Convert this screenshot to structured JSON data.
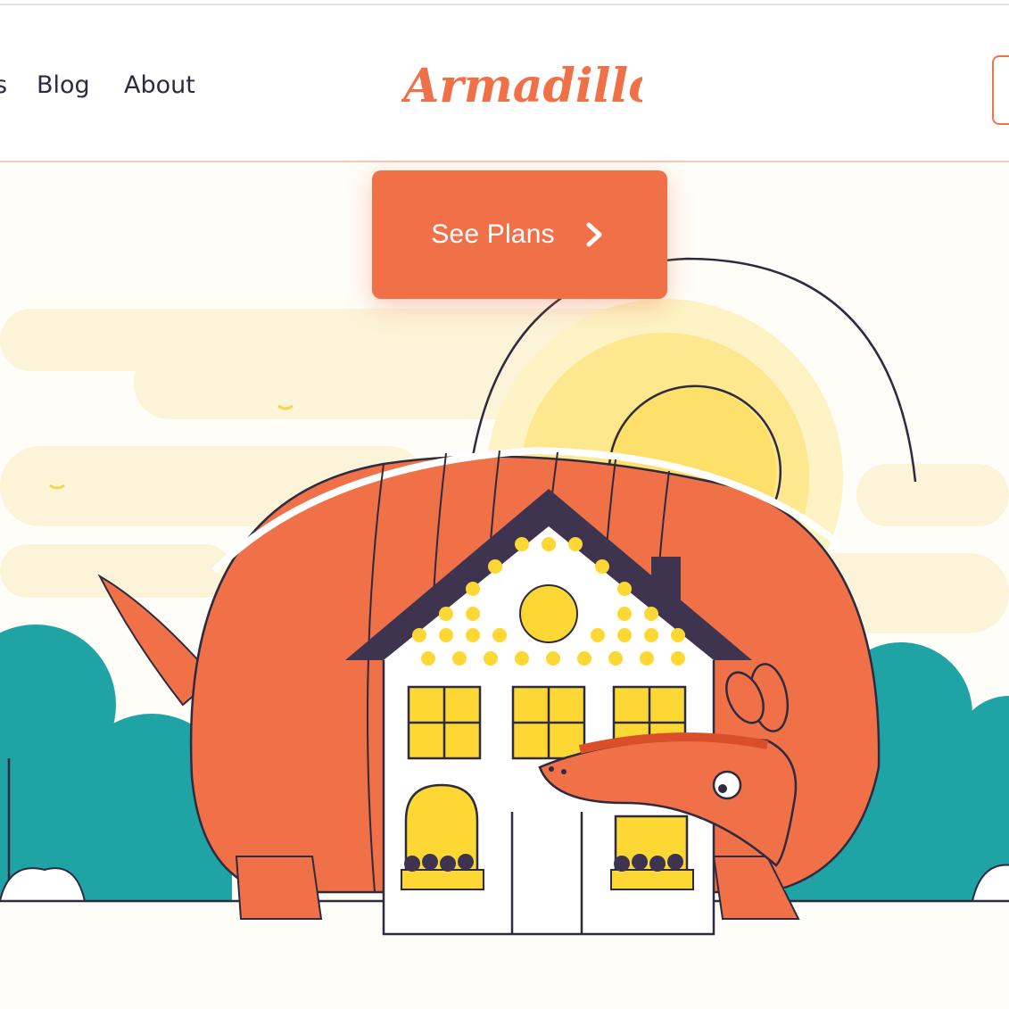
{
  "header": {
    "nav_partial": "s",
    "nav": [
      {
        "label": "Blog"
      },
      {
        "label": "About"
      }
    ],
    "logo_text": "Armadillo"
  },
  "hero": {
    "cta_label": "See Plans",
    "cta_icon": "chevron-right-icon",
    "illustration": "armadillo-around-house"
  },
  "colors": {
    "brand": "#f07148",
    "text": "#2e2a3f",
    "sun": "#fde06a",
    "trees": "#1fa3a5",
    "window_yellow": "#fdd835"
  }
}
